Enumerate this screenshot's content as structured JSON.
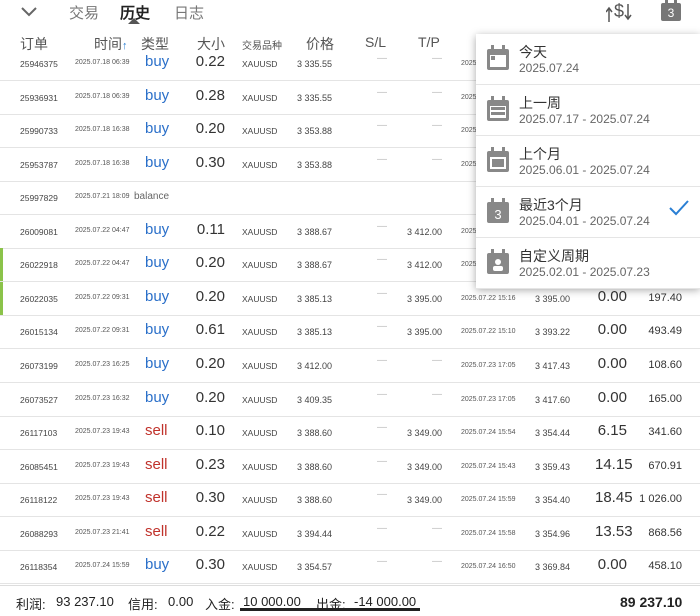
{
  "tabs": [
    {
      "label": "交易",
      "active": false
    },
    {
      "label": "历史",
      "active": true
    },
    {
      "label": "日志",
      "active": false
    }
  ],
  "toolbar": {
    "calendar_badge": "3"
  },
  "columns": {
    "order": "订单",
    "time": "时间",
    "type": "类型",
    "volume": "大小",
    "symbol": "交易品种",
    "price": "价格",
    "sl": "S/L",
    "tp": "T/P"
  },
  "rows": [
    {
      "order": "25946375",
      "time": "2025.07.18 06:39",
      "type": "buy",
      "volume": "0.22",
      "symbol": "XAUUSD",
      "price": "3 335.55",
      "sl": "—",
      "tp": "—",
      "ctime": "2025",
      "cprice": "",
      "swap": "",
      "profit": "",
      "accent": false
    },
    {
      "order": "25936931",
      "time": "2025.07.18 06:39",
      "type": "buy",
      "volume": "0.28",
      "symbol": "XAUUSD",
      "price": "3 335.55",
      "sl": "—",
      "tp": "—",
      "ctime": "2025",
      "cprice": "",
      "swap": "",
      "profit": "",
      "accent": false
    },
    {
      "order": "25990733",
      "time": "2025.07.18 16:38",
      "type": "buy",
      "volume": "0.20",
      "symbol": "XAUUSD",
      "price": "3 353.88",
      "sl": "—",
      "tp": "—",
      "ctime": "2025",
      "cprice": "",
      "swap": "",
      "profit": "",
      "accent": false
    },
    {
      "order": "25953787",
      "time": "2025.07.18 16:38",
      "type": "buy",
      "volume": "0.30",
      "symbol": "XAUUSD",
      "price": "3 353.88",
      "sl": "—",
      "tp": "—",
      "ctime": "2025",
      "cprice": "",
      "swap": "",
      "profit": "",
      "accent": false
    },
    {
      "order": "25997829",
      "time": "2025.07.21 18:09",
      "type": "balance",
      "volume": "",
      "symbol": "",
      "price": "",
      "sl": "",
      "tp": "",
      "ctime": "",
      "cprice": "",
      "swap": "",
      "profit": "",
      "accent": false
    },
    {
      "order": "26009081",
      "time": "2025.07.22 04:47",
      "type": "buy",
      "volume": "0.11",
      "symbol": "XAUUSD",
      "price": "3 388.67",
      "sl": "—",
      "tp": "3 412.00",
      "ctime": "2025",
      "cprice": "",
      "swap": "",
      "profit": "",
      "accent": false
    },
    {
      "order": "26022918",
      "time": "2025.07.22 04:47",
      "type": "buy",
      "volume": "0.20",
      "symbol": "XAUUSD",
      "price": "3 388.67",
      "sl": "—",
      "tp": "3 412.00",
      "ctime": "2025",
      "cprice": "",
      "swap": "",
      "profit": "",
      "accent": true
    },
    {
      "order": "26022035",
      "time": "2025.07.22 09:31",
      "type": "buy",
      "volume": "0.20",
      "symbol": "XAUUSD",
      "price": "3 385.13",
      "sl": "—",
      "tp": "3 395.00",
      "ctime": "2025.07.22 15:16",
      "cprice": "3 395.00",
      "swap": "0.00",
      "profit": "197.40",
      "accent": true
    },
    {
      "order": "26015134",
      "time": "2025.07.22 09:31",
      "type": "buy",
      "volume": "0.61",
      "symbol": "XAUUSD",
      "price": "3 385.13",
      "sl": "—",
      "tp": "3 395.00",
      "ctime": "2025.07.22 15:10",
      "cprice": "3 393.22",
      "swap": "0.00",
      "profit": "493.49",
      "accent": false
    },
    {
      "order": "26073199",
      "time": "2025.07.23 16:25",
      "type": "buy",
      "volume": "0.20",
      "symbol": "XAUUSD",
      "price": "3 412.00",
      "sl": "—",
      "tp": "—",
      "ctime": "2025.07.23 17:05",
      "cprice": "3 417.43",
      "swap": "0.00",
      "profit": "108.60",
      "accent": false
    },
    {
      "order": "26073527",
      "time": "2025.07.23 16:32",
      "type": "buy",
      "volume": "0.20",
      "symbol": "XAUUSD",
      "price": "3 409.35",
      "sl": "—",
      "tp": "—",
      "ctime": "2025.07.23 17:05",
      "cprice": "3 417.60",
      "swap": "0.00",
      "profit": "165.00",
      "accent": false
    },
    {
      "order": "26117103",
      "time": "2025.07.23 19:43",
      "type": "sell",
      "volume": "0.10",
      "symbol": "XAUUSD",
      "price": "3 388.60",
      "sl": "—",
      "tp": "3 349.00",
      "ctime": "2025.07.24 15:54",
      "cprice": "3 354.44",
      "swap": "6.15",
      "profit": "341.60",
      "accent": false
    },
    {
      "order": "26085451",
      "time": "2025.07.23 19:43",
      "type": "sell",
      "volume": "0.23",
      "symbol": "XAUUSD",
      "price": "3 388.60",
      "sl": "—",
      "tp": "3 349.00",
      "ctime": "2025.07.24 15:43",
      "cprice": "3 359.43",
      "swap": "14.15",
      "profit": "670.91",
      "accent": false
    },
    {
      "order": "26118122",
      "time": "2025.07.23 19:43",
      "type": "sell",
      "volume": "0.30",
      "symbol": "XAUUSD",
      "price": "3 388.60",
      "sl": "—",
      "tp": "3 349.00",
      "ctime": "2025.07.24 15:59",
      "cprice": "3 354.40",
      "swap": "18.45",
      "profit": "1 026.00",
      "accent": false
    },
    {
      "order": "26088293",
      "time": "2025.07.23 21:41",
      "type": "sell",
      "volume": "0.22",
      "symbol": "XAUUSD",
      "price": "3 394.44",
      "sl": "—",
      "tp": "—",
      "ctime": "2025.07.24 15:58",
      "cprice": "3 354.96",
      "swap": "13.53",
      "profit": "868.56",
      "accent": false
    },
    {
      "order": "26118354",
      "time": "2025.07.24 15:59",
      "type": "buy",
      "volume": "0.30",
      "symbol": "XAUUSD",
      "price": "3 354.57",
      "sl": "—",
      "tp": "—",
      "ctime": "2025.07.24 16:50",
      "cprice": "3 369.84",
      "swap": "0.00",
      "profit": "458.10",
      "accent": false
    }
  ],
  "dropdown": {
    "items": [
      {
        "title": "今天",
        "range": "2025.07.24",
        "icon": "calendar-today-icon",
        "checked": false
      },
      {
        "title": "上一周",
        "range": "2025.07.17 - 2025.07.24",
        "icon": "calendar-week-icon",
        "checked": false
      },
      {
        "title": "上个月",
        "range": "2025.06.01 - 2025.07.24",
        "icon": "calendar-month-icon",
        "checked": false
      },
      {
        "title": "最近3个月",
        "range": "2025.04.01 - 2025.07.24",
        "icon": "calendar-3months-icon",
        "checked": true,
        "badge": "3"
      },
      {
        "title": "自定义周期",
        "range": "2025.02.01 - 2025.07.23",
        "icon": "calendar-custom-icon",
        "checked": false
      }
    ]
  },
  "footer": {
    "profit_label": "利润:",
    "profit_value": "93 237.10",
    "credit_label": "信用:",
    "credit_value": "0.00",
    "deposit_label": "入金:",
    "deposit_value": "10 000.00",
    "withdraw_label": "出金:",
    "withdraw_value": "-14 000.00",
    "total": "89 237.10"
  },
  "colors": {
    "buy": "#2a6fc9",
    "sell": "#c0322b",
    "accent": "#8bc34a",
    "check": "#2a7fd4"
  }
}
